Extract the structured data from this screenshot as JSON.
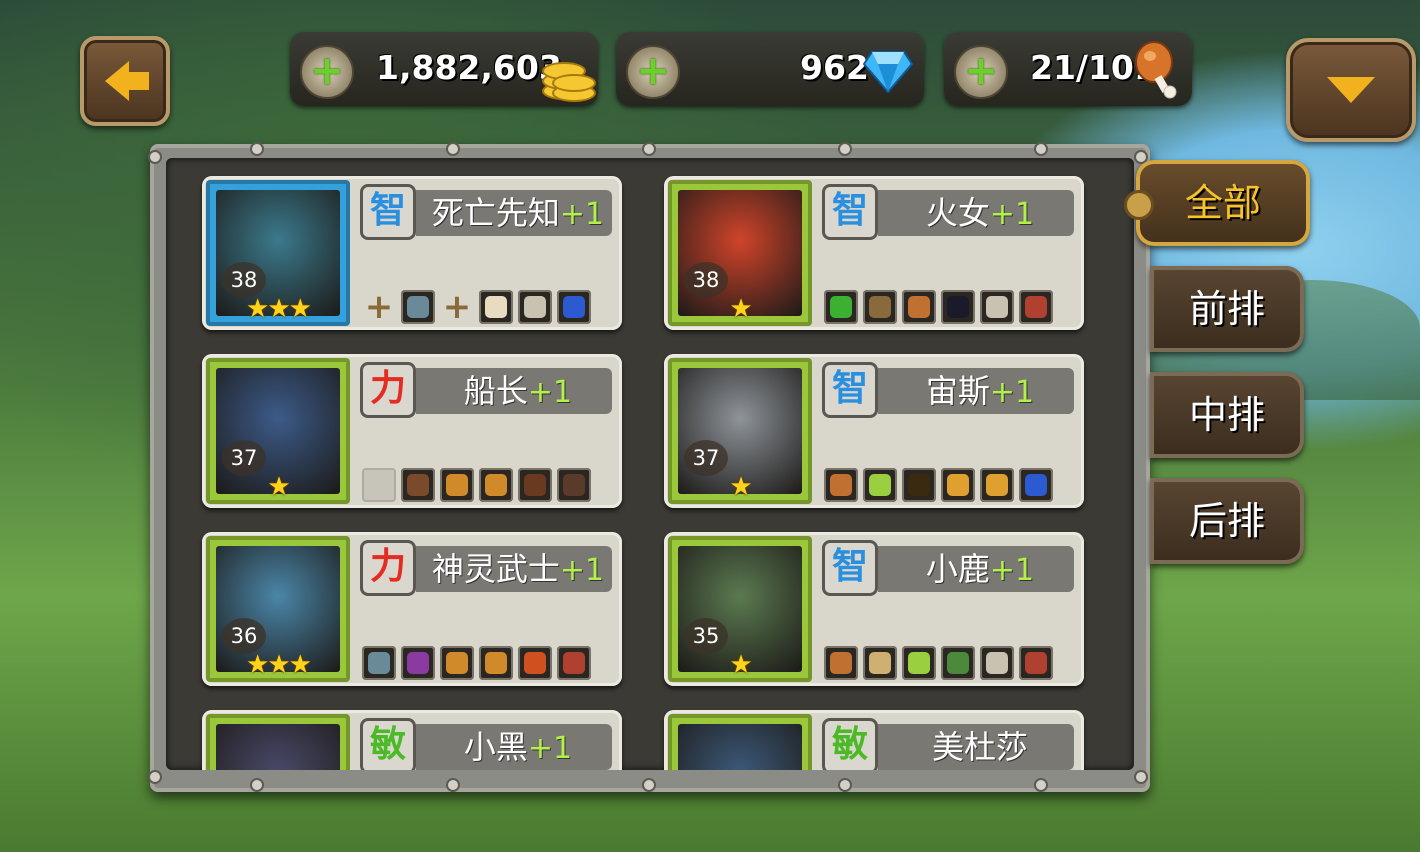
{
  "resources": {
    "gold": "1,882,603",
    "gems": "962",
    "stamina": "21/101"
  },
  "icons": {
    "back": "back-arrow-icon",
    "menu": "dropdown-arrow-icon",
    "add": "plus-icon",
    "gold": "gold-coins-icon",
    "gem": "diamond-icon",
    "stamina": "meat-drumstick-icon"
  },
  "tabs": [
    {
      "label": "全部",
      "active": true
    },
    {
      "label": "前排",
      "active": false
    },
    {
      "label": "中排",
      "active": false
    },
    {
      "label": "后排",
      "active": false
    }
  ],
  "heroes": [
    {
      "name": "死亡先知",
      "plus": "+1",
      "attr": "智",
      "attr_type": "int",
      "level": "38",
      "stars": "★★★",
      "frame": "blue",
      "face": "#3b7a8c",
      "equip": [
        "plus-slot",
        "axe",
        "plus-slot",
        "drum",
        "skull-helm",
        "blue-boot"
      ]
    },
    {
      "name": "火女",
      "plus": "+1",
      "attr": "智",
      "attr_type": "int",
      "level": "38",
      "stars": "★",
      "frame": "green",
      "face": "#d0442a",
      "equip": [
        "green-blade",
        "dagger",
        "club",
        "dark-ring",
        "skull-helm",
        "red-boot"
      ]
    },
    {
      "name": "船长",
      "plus": "+1",
      "attr": "力",
      "attr_type": "str",
      "level": "37",
      "stars": "★",
      "frame": "green",
      "face": "#3c5b8a",
      "equip": [
        "empty",
        "shield",
        "barrel",
        "barrel",
        "mask",
        "boot"
      ]
    },
    {
      "name": "宙斯",
      "plus": "+1",
      "attr": "智",
      "attr_type": "int",
      "level": "37",
      "stars": "★",
      "frame": "green",
      "face": "#8e949a",
      "equip": [
        "club",
        "wand",
        "ring",
        "compass",
        "compass",
        "blue-boot"
      ]
    },
    {
      "name": "神灵武士",
      "plus": "+1",
      "attr": "力",
      "attr_type": "str",
      "level": "36",
      "stars": "★★★",
      "frame": "green",
      "face": "#4a86a8",
      "equip": [
        "axe",
        "potion",
        "barrel",
        "barrel",
        "gong",
        "red-boot"
      ]
    },
    {
      "name": "小鹿",
      "plus": "+1",
      "attr": "智",
      "attr_type": "int",
      "level": "35",
      "stars": "★",
      "frame": "green",
      "face": "#5b7a50",
      "equip": [
        "club",
        "scroll",
        "wand",
        "hood",
        "skull-helm",
        "red-boot"
      ]
    },
    {
      "name": "小黑",
      "plus": "+1",
      "attr": "敏",
      "attr_type": "agi",
      "frame": "green",
      "face": "#4a4a6a"
    },
    {
      "name": "美杜莎",
      "plus": "",
      "attr": "敏",
      "attr_type": "agi",
      "frame": "green",
      "face": "#3c5a7a"
    }
  ],
  "colors": {
    "accent_gold": "#f6c32a",
    "plus_green": "#b2f04a",
    "int_blue": "#2b8fe0",
    "str_red": "#e42c22",
    "agi_green": "#4cb927"
  }
}
